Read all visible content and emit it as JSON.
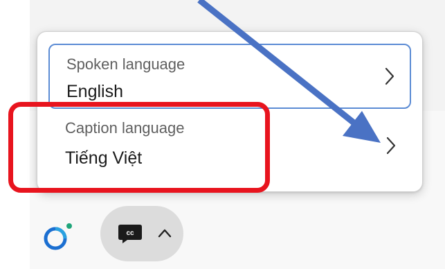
{
  "flyout": {
    "items": [
      {
        "label": "Spoken language",
        "value": "English",
        "icon": "chevron-right-icon"
      },
      {
        "label": "Caption language",
        "value": "Tiếng Việt",
        "icon": "chevron-right-icon"
      }
    ]
  },
  "taskbar": {
    "copilot_icon": "copilot-icon",
    "captions_button_icon": "closed-captions-icon",
    "expand_icon": "caret-up-icon"
  },
  "colors": {
    "focus_border": "#5b8bd4",
    "highlight": "#e8141e",
    "arrow": "#4a72c4",
    "copilot_blue": "#1b6fd1",
    "copilot_green": "#1fa57a"
  }
}
